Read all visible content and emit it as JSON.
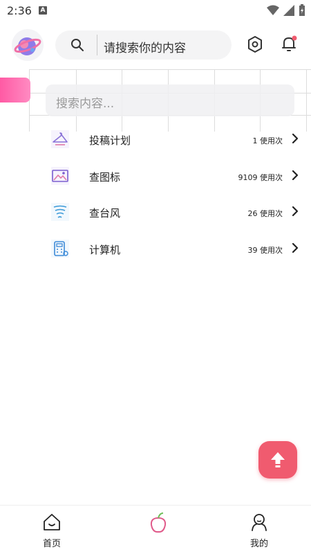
{
  "status_bar": {
    "time": "2:36",
    "indicator": "A"
  },
  "header": {
    "search_placeholder": "请搜索你的内容"
  },
  "search_box": {
    "placeholder": "搜索内容..."
  },
  "tools": [
    {
      "name": "投稿计划",
      "usage": "1 使用次",
      "icon": "hanger-icon",
      "color": "#8a72d8"
    },
    {
      "name": "查图标",
      "usage": "9109 使用次",
      "icon": "image-gallery-icon",
      "color": "#7a5ccf"
    },
    {
      "name": "查台风",
      "usage": "26 使用次",
      "icon": "typhoon-icon",
      "color": "#3c9ad8"
    },
    {
      "name": "计算机",
      "usage": "39 使用次",
      "icon": "calculator-icon",
      "color": "#3c8ad8"
    }
  ],
  "bottom_nav": {
    "home": "首页",
    "mine": "我的"
  },
  "colors": {
    "accent": "#f05b6f",
    "pink": "#ff5aa4"
  }
}
